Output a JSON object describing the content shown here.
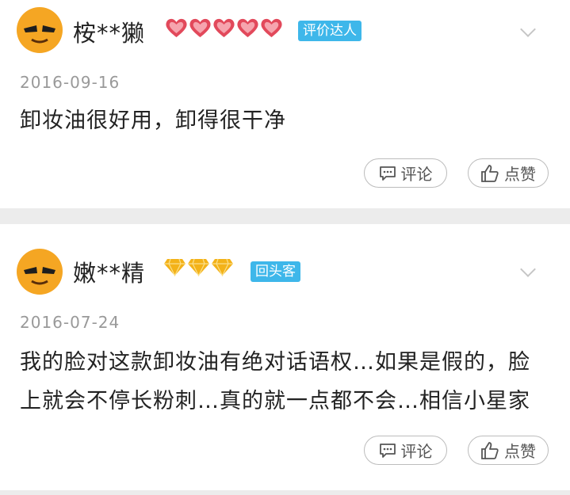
{
  "reviews": [
    {
      "username": "桉**獭",
      "level_icon": "heart-icon",
      "level_count": 5,
      "badge": "评价达人",
      "date": "2016-09-16",
      "content": "卸妆油很好用，卸得很干净",
      "comment_label": "评论",
      "like_label": "点赞"
    },
    {
      "username": "嫩**精",
      "level_icon": "diamond-icon",
      "level_count": 3,
      "badge": "回头客",
      "date": "2016-07-24",
      "content": "我的脸对这款卸妆油有绝对话语权…如果是假的，脸上就会不停长粉刺…真的就一点都不会…相信小星家",
      "comment_label": "评论",
      "like_label": "点赞"
    }
  ],
  "colors": {
    "badge": "#3eb7ea",
    "heart": "#e2495b",
    "diamond": "#f3b219",
    "avatar": "#f5a623"
  }
}
